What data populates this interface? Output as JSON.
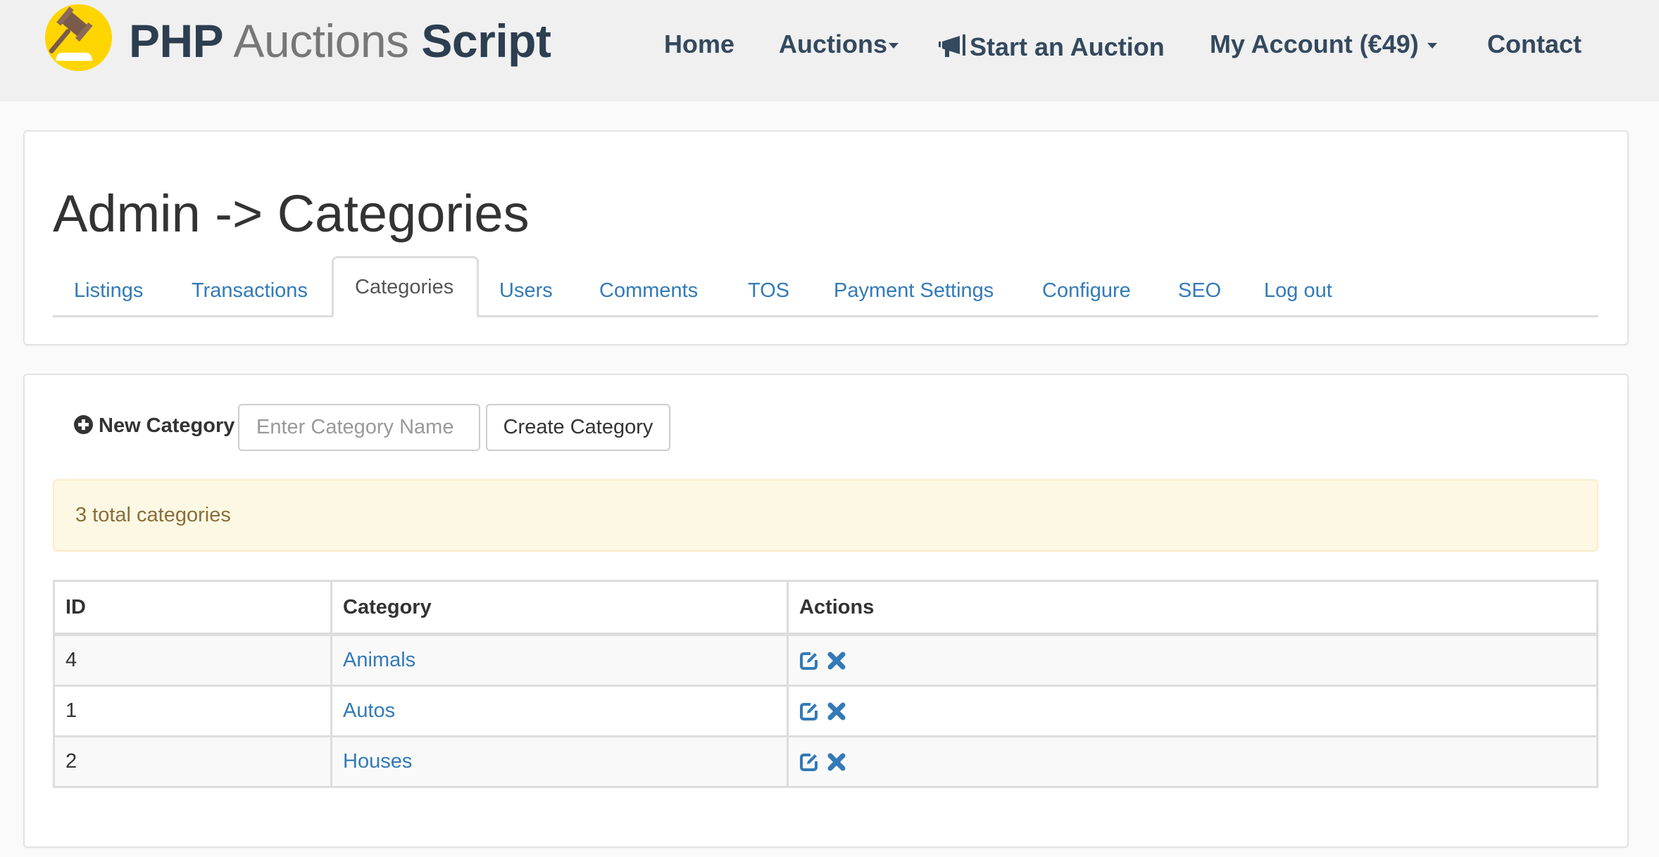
{
  "brand": {
    "part1": "PHP",
    "part2": "Auctions",
    "part3": "Script",
    "logo_icon": "gavel-icon"
  },
  "nav": {
    "home": "Home",
    "auctions": "Auctions",
    "start_auction": "Start an Auction",
    "start_auction_icon": "bullhorn-icon",
    "my_account": "My Account (€49)",
    "contact": "Contact"
  },
  "page": {
    "title": "Admin -> Categories"
  },
  "tabs": [
    {
      "label": "Listings",
      "active": false
    },
    {
      "label": "Transactions",
      "active": false
    },
    {
      "label": "Categories",
      "active": true
    },
    {
      "label": "Users",
      "active": false
    },
    {
      "label": "Comments",
      "active": false
    },
    {
      "label": "TOS",
      "active": false
    },
    {
      "label": "Payment Settings",
      "active": false
    },
    {
      "label": "Configure",
      "active": false
    },
    {
      "label": "SEO",
      "active": false
    },
    {
      "label": "Log out",
      "active": false
    }
  ],
  "new_category": {
    "label": "New Category",
    "input_value": "",
    "input_placeholder": "Enter Category Name",
    "button_label": "Create Category"
  },
  "alert": {
    "text": "3 total categories"
  },
  "table": {
    "headers": [
      "ID",
      "Category",
      "Actions"
    ],
    "rows": [
      {
        "id": "4",
        "category": "Animals",
        "actions": [
          "edit-icon",
          "delete-icon"
        ]
      },
      {
        "id": "1",
        "category": "Autos",
        "actions": [
          "edit-icon",
          "delete-icon"
        ]
      },
      {
        "id": "2",
        "category": "Houses",
        "actions": [
          "edit-icon",
          "delete-icon"
        ]
      }
    ]
  },
  "colors": {
    "link": "#337ab7",
    "nav_text": "#34495e",
    "logo_yellow": "#ffd500",
    "alert_bg": "#fcf8e3",
    "alert_text": "#8a6d3b"
  }
}
